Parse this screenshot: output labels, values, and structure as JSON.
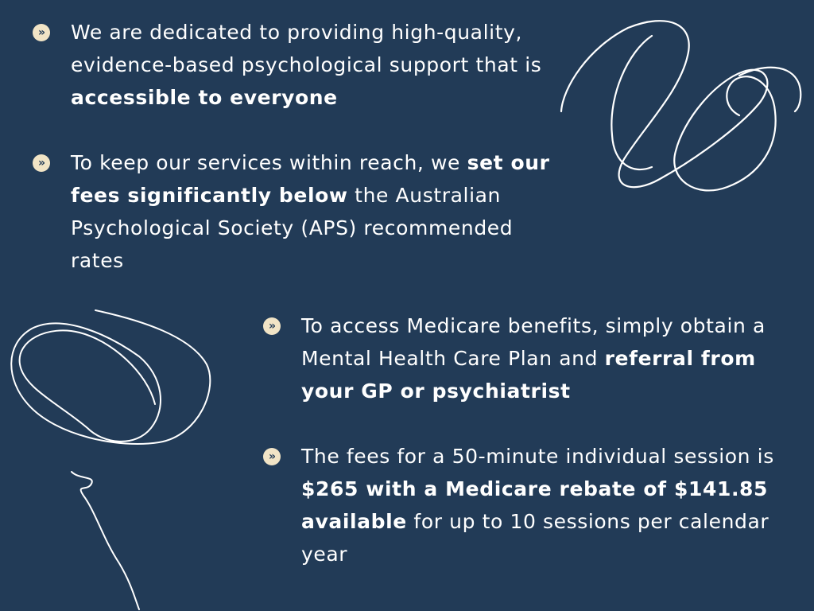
{
  "bullets": [
    {
      "icon": "double-chevron-right-icon",
      "parts": [
        "We are dedicated to providing high-quality, evidence-based psychological support that is ",
        "accessible to everyone"
      ]
    },
    {
      "icon": "double-chevron-right-icon",
      "parts": [
        "To keep our services within reach, we ",
        "set our fees significantly below",
        " the Australian Psychological Society (APS) recommended rates"
      ]
    },
    {
      "icon": "double-chevron-right-icon",
      "parts": [
        "To access Medicare benefits, simply obtain a Mental Health Care Plan and ",
        "referral from your GP or psychiatrist"
      ]
    },
    {
      "icon": "double-chevron-right-icon",
      "parts": [
        "The fees for a 50-minute individual session is ",
        "$265 with a Medicare rebate of $141.85 available",
        " for up to 10 sessions per calendar year"
      ]
    }
  ],
  "marker_glyph": "»",
  "colors": {
    "background": "#223b57",
    "text": "#ffffff",
    "marker": "#f1e4c6"
  }
}
